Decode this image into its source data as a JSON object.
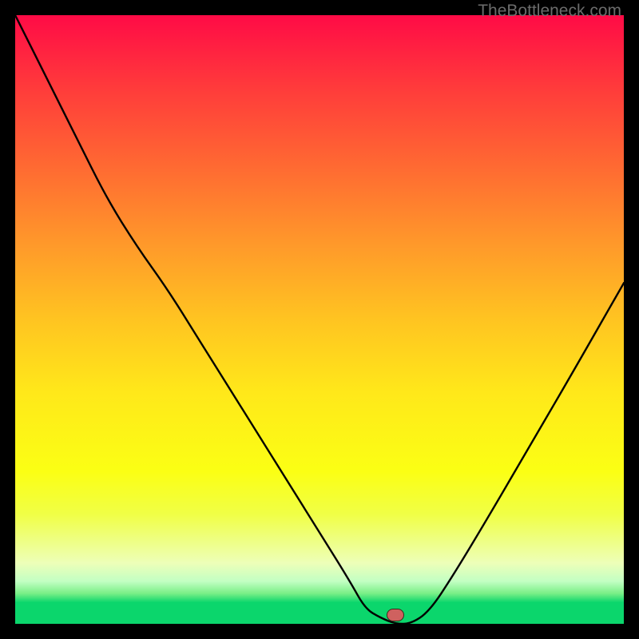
{
  "watermark": "TheBottleneck.com",
  "marker": {
    "x_frac": 0.625,
    "y_frac": 0.985
  },
  "chart_data": {
    "type": "line",
    "title": "",
    "xlabel": "",
    "ylabel": "",
    "xlim": [
      0,
      1
    ],
    "ylim": [
      0,
      1
    ],
    "series": [
      {
        "name": "bottleneck-curve",
        "x": [
          0.0,
          0.05,
          0.1,
          0.15,
          0.2,
          0.25,
          0.3,
          0.35,
          0.4,
          0.45,
          0.5,
          0.55,
          0.575,
          0.6,
          0.625,
          0.65,
          0.68,
          0.72,
          0.78,
          0.85,
          0.92,
          1.0
        ],
        "y": [
          1.0,
          0.9,
          0.8,
          0.7,
          0.62,
          0.55,
          0.47,
          0.39,
          0.31,
          0.23,
          0.15,
          0.07,
          0.025,
          0.01,
          0.0,
          0.0,
          0.02,
          0.08,
          0.18,
          0.3,
          0.42,
          0.56
        ]
      }
    ],
    "annotations": [
      {
        "type": "marker",
        "x": 0.625,
        "y": 0.0,
        "color": "#cf615f"
      }
    ]
  }
}
